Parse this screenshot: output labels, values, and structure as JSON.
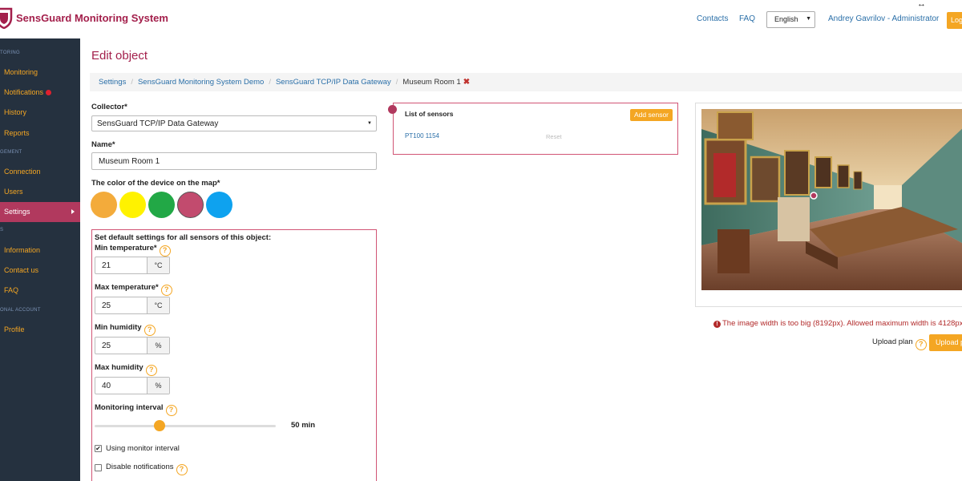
{
  "app": {
    "title": "SensGuard Monitoring System"
  },
  "header": {
    "contacts": "Contacts",
    "faq": "FAQ",
    "language": "English",
    "user": "Andrey Gavrilov - Administrator",
    "logout": "Log"
  },
  "sidebar": {
    "sections": [
      "TORING",
      "GEMENT",
      "S",
      "ONAL ACCOUNT"
    ],
    "items": [
      {
        "label": "Monitoring"
      },
      {
        "label": "Notifications"
      },
      {
        "label": "History"
      },
      {
        "label": "Reports"
      },
      {
        "label": "Connection"
      },
      {
        "label": "Users"
      },
      {
        "label": "Settings"
      },
      {
        "label": "Information"
      },
      {
        "label": "Contact us"
      },
      {
        "label": "FAQ"
      },
      {
        "label": "Profile"
      }
    ]
  },
  "page": {
    "title": "Edit object"
  },
  "breadcrumb": {
    "items": [
      "Settings",
      "SensGuard Monitoring System Demo",
      "SensGuard TCP/IP Data Gateway"
    ],
    "current": "Museum Room 1"
  },
  "form": {
    "collector_label": "Collector*",
    "collector_value": "SensGuard TCP/IP Data Gateway",
    "name_label": "Name*",
    "name_value": "Museum Room 1",
    "color_label": "The color of the device on the map*",
    "colors": [
      "#f3ab3b",
      "#fff200",
      "#22a846",
      "#c24b6e",
      "#0ea2ef"
    ],
    "selected_color_index": 3,
    "defaults_title": "Set default settings for all sensors of this object:",
    "min_temp_label": "Min temperature*",
    "min_temp_value": "21",
    "max_temp_label": "Max temperature*",
    "max_temp_value": "25",
    "temp_unit": "°C",
    "min_hum_label": "Min humidity",
    "min_hum_value": "25",
    "max_hum_label": "Max humidity",
    "max_hum_value": "40",
    "hum_unit": "%",
    "interval_label": "Monitoring interval",
    "interval_value": "50 min",
    "interval_fraction": 0.36,
    "use_monitor_interval_label": "Using monitor interval",
    "use_monitor_interval_checked": true,
    "disable_notifications_label": "Disable notifications",
    "disable_notifications_checked": false,
    "help": "?"
  },
  "sensors": {
    "title": "List of sensors",
    "add_button": "Add sensor",
    "items": [
      {
        "name": "PT100 1154",
        "action": "Reset"
      }
    ]
  },
  "plan": {
    "error": "The image width is too big (8192px). Allowed maximum width is 4128px.",
    "upload_label": "Upload plan",
    "upload_button": "Upload p"
  }
}
